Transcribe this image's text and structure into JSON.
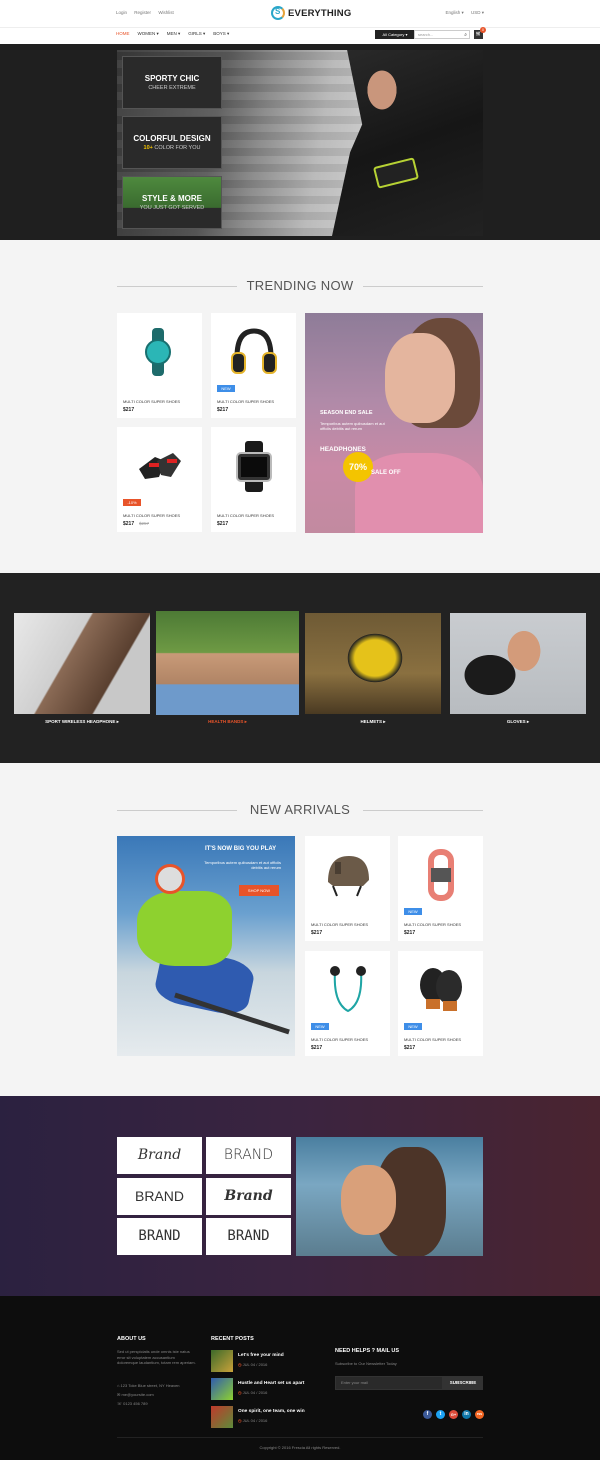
{
  "header": {
    "top_links": [
      "Login",
      "Register",
      "Wishlist"
    ],
    "logo_mark": "S",
    "logo_text": "EVERYTHING",
    "language": "English ▾",
    "currency": "USD ▾",
    "nav": [
      "HOME",
      "WOMEN ▾",
      "MEN ▾",
      "GIRLS ▾",
      "BOYS ▾"
    ],
    "category_button": "All Category ▾",
    "search_placeholder": "search...",
    "cart_count": "0"
  },
  "hero": {
    "box1_title": "SPORTY CHIC",
    "box1_sub": "CHEER EXTREME",
    "box2_title": "COLORFUL DESIGN",
    "box2_sub_accent": "10+",
    "box2_sub": " COLOR FOR YOU",
    "box3_title": "STYLE & MORE",
    "box3_sub": "YOU JUST GOT SERVED"
  },
  "trending": {
    "title": "TRENDING NOW",
    "products": [
      {
        "name": "MULTI COLOR SUPER SHOES",
        "price": "$217",
        "old_price": "",
        "badge": "",
        "icon": "fitness-band"
      },
      {
        "name": "MULTI COLOR SUPER SHOES",
        "price": "$217",
        "old_price": "",
        "badge": "NEW",
        "icon": "headphones"
      },
      {
        "name": "MULTI COLOR SUPER SHOES",
        "price": "$217",
        "old_price": "$257",
        "badge": "-10%",
        "icon": "gloves"
      },
      {
        "name": "MULTI COLOR SUPER SHOES",
        "price": "$217",
        "old_price": "",
        "badge": "",
        "icon": "smartwatch"
      }
    ],
    "promo": {
      "title": "SEASON END SALE",
      "text": "Temporibus autem quibusdam et aut officiis debitis aut rerum",
      "label": "HEADPHONES",
      "percent": "70%",
      "sale": "SALE OFF"
    }
  },
  "categories": [
    {
      "label": "SPORT WIRELESS HEADPHONE ▸",
      "active": false
    },
    {
      "label": "HEALTH BANDS ▸",
      "active": true
    },
    {
      "label": "HELMETS ▸",
      "active": false
    },
    {
      "label": "GLOVES ▸",
      "active": false
    }
  ],
  "arrivals": {
    "title": "NEW ARRIVALS",
    "promo": {
      "title": "IT'S NOW BIG YOU PLAY",
      "text": "Temporibus autem quibusdam et aut officiis debitis aut rerum",
      "button": "SHOP NOW"
    },
    "products": [
      {
        "name": "MULTI COLOR SUPER SHOES",
        "price": "$217",
        "badge": "",
        "icon": "helmet"
      },
      {
        "name": "MULTI COLOR SUPER SHOES",
        "price": "$217",
        "badge": "NEW",
        "icon": "band"
      },
      {
        "name": "MULTI COLOR SUPER SHOES",
        "price": "$217",
        "badge": "NEW",
        "icon": "earphones"
      },
      {
        "name": "MULTI COLOR SUPER SHOES",
        "price": "$217",
        "badge": "NEW",
        "icon": "boxing-gloves"
      }
    ]
  },
  "brands": [
    "Brand",
    "BRAND",
    "BRAND",
    "Brand",
    "BRAND",
    "BRAND"
  ],
  "footer": {
    "about_title": "ABOUT US",
    "about_text": "Sed ut perspiciatis unde omnis iste natus error sit voluptatem accusantium doloremque laudantium, totam rem aperiam.",
    "address": "123 Toke Blue street, NY Heaven",
    "email": "me@yoursite.com",
    "phone": "0123 456 789",
    "posts_title": "RECENT POSTS",
    "posts": [
      {
        "title": "Let's free your mind",
        "date": "JUL 04 / 2016"
      },
      {
        "title": "Hustle and Heart set us apart",
        "date": "JUL 04 / 2016"
      },
      {
        "title": "One spirit, one team, one win",
        "date": "JUL 04 / 2016"
      }
    ],
    "newsletter_title": "NEED HELPS ? MAIL US",
    "newsletter_text": "Subscribe to Our Newsletter Today",
    "email_placeholder": "Enter your mail",
    "subscribe": "SUBSCRIBE",
    "social": [
      "f",
      "t",
      "G+",
      "in",
      "rss"
    ],
    "social_colors": [
      "#3b5998",
      "#1da1f2",
      "#dd4b39",
      "#0e76a8",
      "#f26522"
    ],
    "copyright": "Copyright © 2016 Frescia All rights Reserved."
  }
}
